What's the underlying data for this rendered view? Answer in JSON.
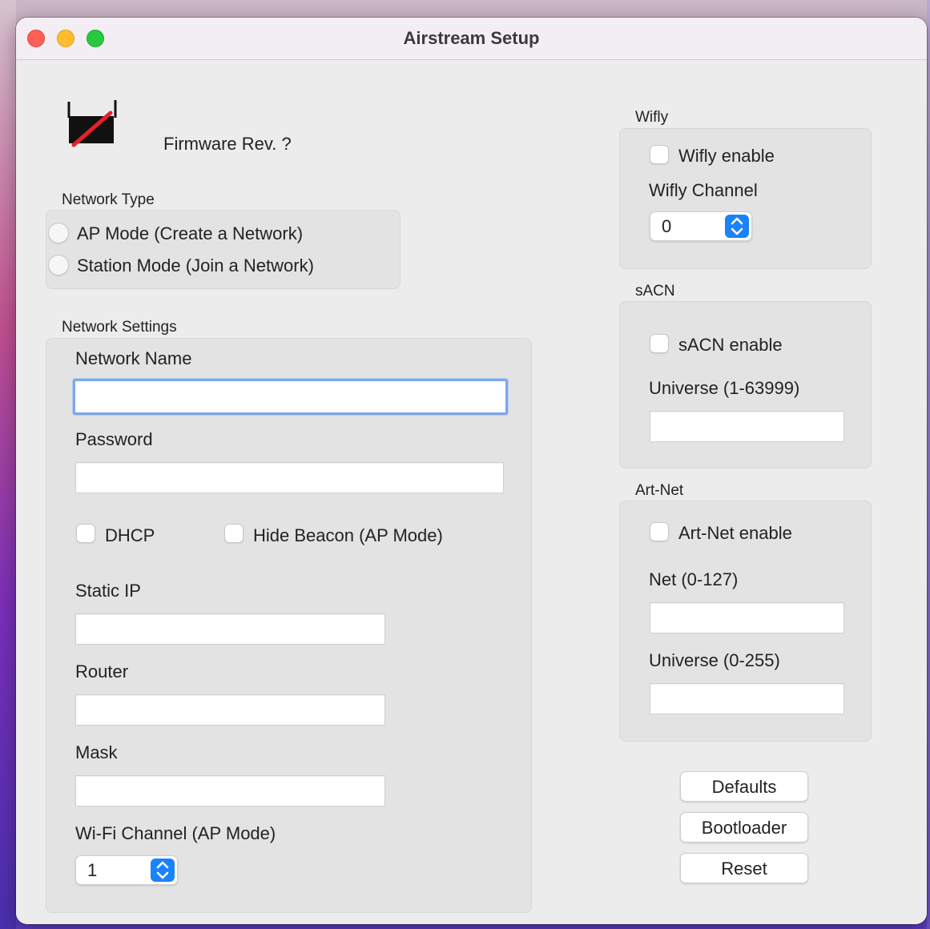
{
  "window": {
    "title": "Airstream Setup"
  },
  "header": {
    "firmware_label": "Firmware Rev. ?"
  },
  "network_type": {
    "title": "Network Type",
    "options": [
      "AP Mode (Create a Network)",
      "Station Mode (Join a Network)"
    ]
  },
  "network_settings": {
    "title": "Network Settings",
    "network_name_label": "Network Name",
    "network_name_value": "",
    "password_label": "Password",
    "password_value": "",
    "dhcp_label": "DHCP",
    "hide_beacon_label": "Hide Beacon (AP Mode)",
    "static_ip_label": "Static IP",
    "router_label": "Router",
    "mask_label": "Mask",
    "wifi_channel_label": "Wi-Fi Channel (AP Mode)",
    "wifi_channel_value": "1"
  },
  "wifly": {
    "title": "Wifly",
    "enable_label": "Wifly enable",
    "channel_label": "Wifly Channel",
    "channel_value": "0"
  },
  "sacn": {
    "title": "sACN",
    "enable_label": "sACN enable",
    "universe_label": "Universe (1-63999)"
  },
  "artnet": {
    "title": "Art-Net",
    "enable_label": "Art-Net enable",
    "net_label": "Net (0-127)",
    "universe_label": "Universe (0-255)"
  },
  "buttons": {
    "defaults": "Defaults",
    "bootloader": "Bootloader",
    "reset": "Reset"
  },
  "colors": {
    "accent": "#1a82fb",
    "focus_ring": "#7da7ea",
    "close": "#ff5f57",
    "minimize": "#febc2e",
    "maximize": "#28c840"
  },
  "icons": {
    "device_icon": "router-disconnected-icon"
  }
}
